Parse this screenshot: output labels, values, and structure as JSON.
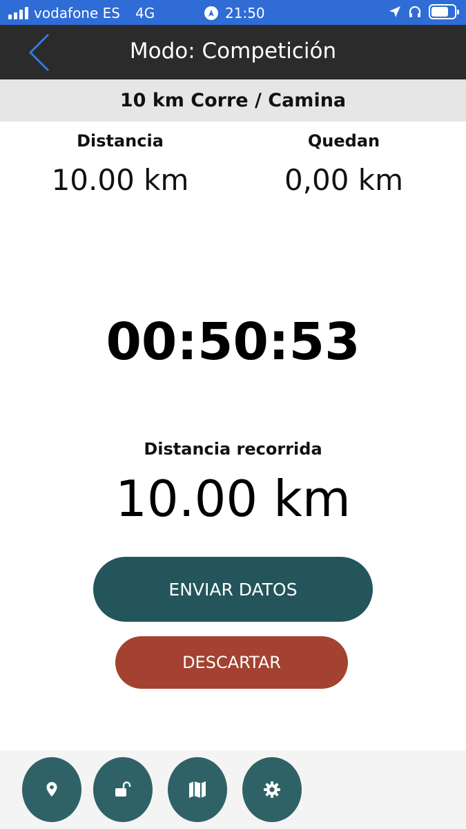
{
  "status_bar": {
    "carrier": "vodafone ES",
    "network": "4G",
    "time": "21:50",
    "battery_level": 0.75
  },
  "header": {
    "title": "Modo: Competición",
    "back_icon": "chevron-left-icon"
  },
  "event": {
    "name": "10 km Corre / Camina"
  },
  "stats": {
    "distance_label": "Distancia",
    "distance_value": "10.00 km",
    "remaining_label": "Quedan",
    "remaining_value": "0,00 km"
  },
  "timer": {
    "value": "00:50:53"
  },
  "traveled": {
    "label": "Distancia recorrida",
    "value": "10.00 km"
  },
  "actions": {
    "send_label": "ENVIAR DATOS",
    "discard_label": "DESCARTAR"
  },
  "bottom_bar": {
    "icons": [
      "location-pin-icon",
      "unlock-icon",
      "map-icon",
      "settings-icon"
    ]
  },
  "colors": {
    "status_bar": "#2f6cd6",
    "header": "#2b2b2b",
    "send_button": "#23555b",
    "discard_button": "#a34230",
    "fab": "#2f6266"
  }
}
